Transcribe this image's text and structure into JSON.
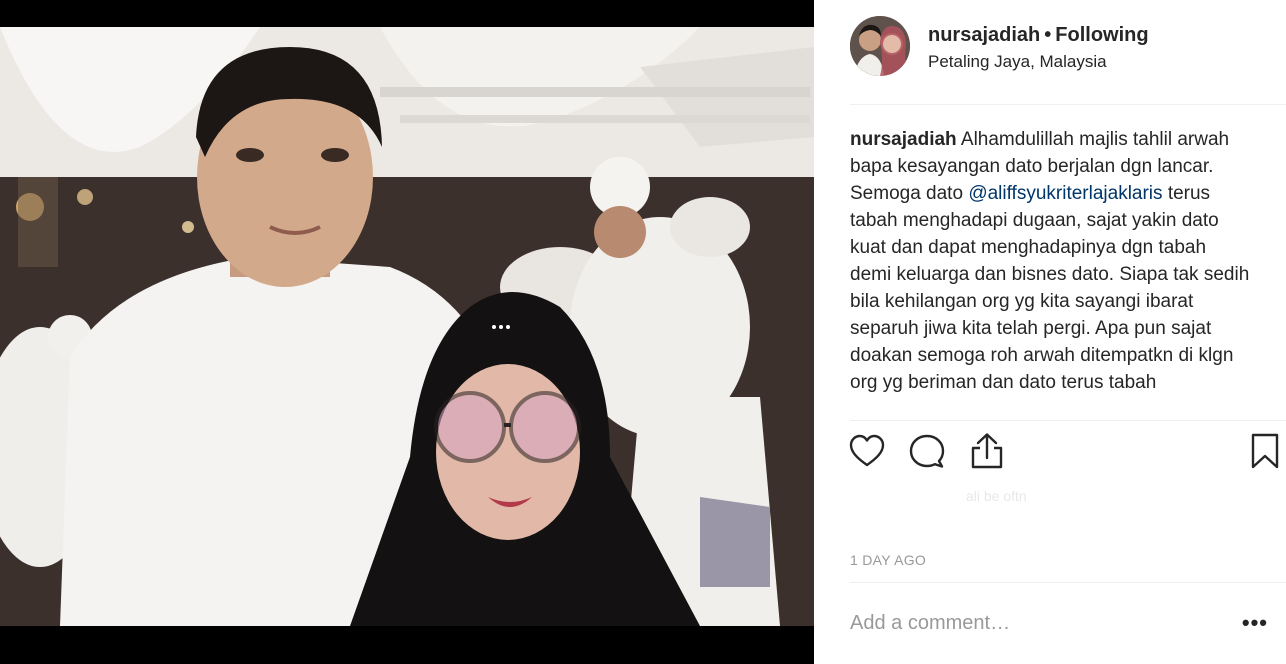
{
  "post": {
    "username": "nursajadiah",
    "separator": "•",
    "follow_status": "Following",
    "location": "Petaling Jaya, Malaysia",
    "caption": {
      "username": "nursajadiah",
      "text_before": "Alhamdulillah majlis tahlil arwah bapa kesayangan dato berjalan dgn lancar. Semoga dato",
      "mention": "@aliffsyukriterlajaklaris",
      "text_after": "terus tabah menghadapi dugaan, sajat yakin dato kuat dan dapat menghadapinya dgn tabah demi keluarga dan bisnes dato. Siapa tak sedih bila kehilangan org yg kita sayangi ibarat separuh jiwa kita telah pergi. Apa pun sajat doakan semoga roh arwah ditempatkn di klgn org yg beriman dan dato terus tabah"
    },
    "faint_text": "ali be oftn",
    "timestamp": "1 DAY AGO",
    "comment_placeholder": "Add a comment…",
    "more_label": "•••"
  },
  "icons": {
    "like": "heart-icon",
    "comment": "comment-bubble-icon",
    "share": "share-icon",
    "save": "bookmark-icon"
  },
  "colors": {
    "text": "#262626",
    "muted": "#999999",
    "mention": "#003569",
    "divider": "#efefef",
    "media_bg": "#000000"
  }
}
